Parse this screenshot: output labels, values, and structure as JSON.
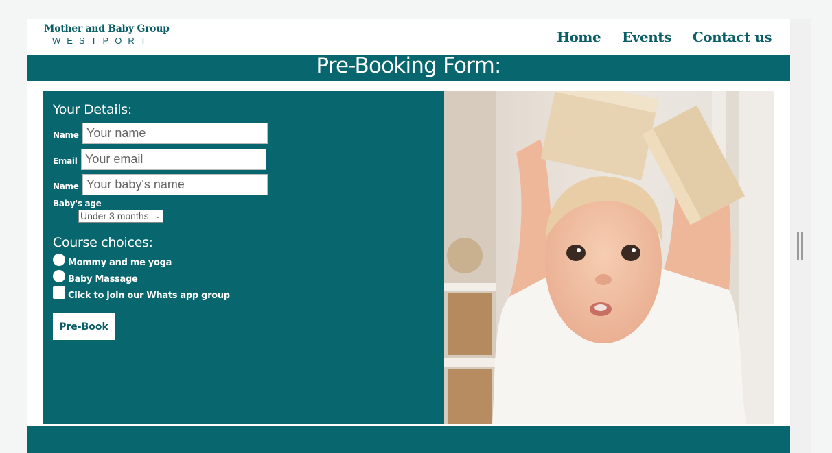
{
  "header": {
    "logo_line1": "Mother and Baby Group",
    "logo_line2": "WESTPORT",
    "nav": [
      "Home",
      "Events",
      "Contact us"
    ]
  },
  "title": "Pre-Booking Form:",
  "form": {
    "details_heading": "Your Details:",
    "name_label": "Name",
    "name_placeholder": "Your name",
    "email_label": "Email",
    "email_placeholder": "Your email",
    "baby_name_label": "Name",
    "baby_name_placeholder": "Your baby's name",
    "age_label": "Baby's age",
    "age_selected": "Under 3 months",
    "courses_heading": "Course choices:",
    "option_yoga": "Mommy and me yoga",
    "option_massage": "Baby Massage",
    "option_whatsapp": "Click to join our Whats app group",
    "submit_label": "Pre-Book"
  },
  "colors": {
    "brand_teal": "#08666e",
    "background": "#f4f5f5"
  }
}
